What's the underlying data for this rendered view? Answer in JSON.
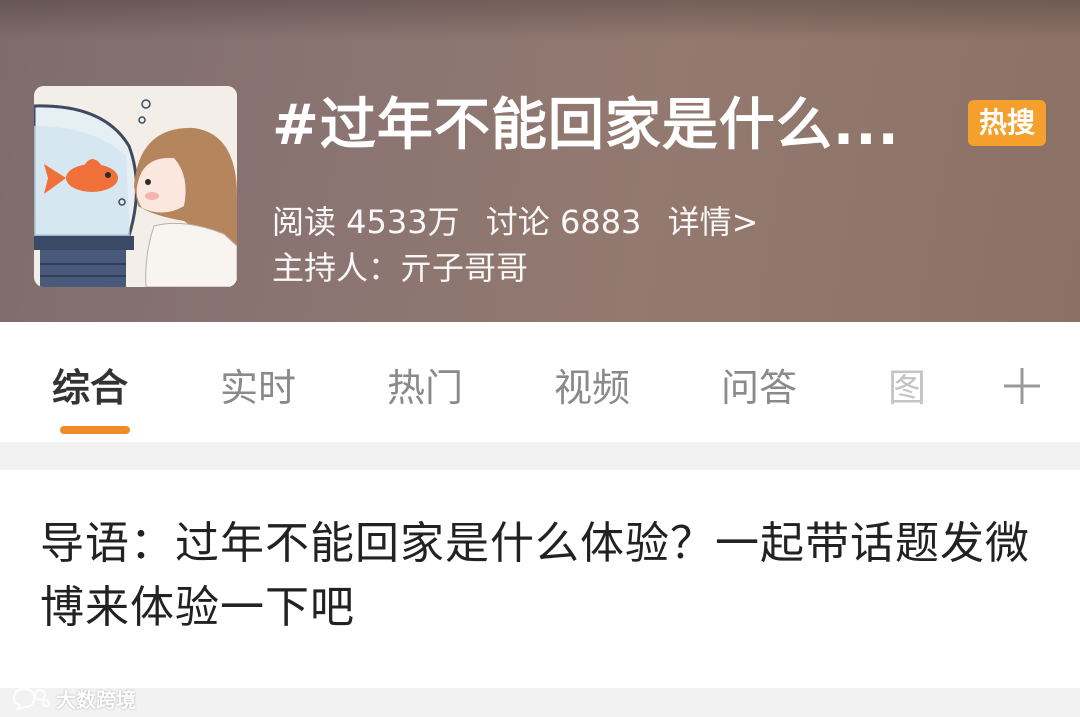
{
  "topic": {
    "title": "#过年不能回家是什么...",
    "badge": "热搜",
    "reads": "阅读 4533万",
    "discussions": "讨论 6883",
    "details_link": "详情>",
    "host": "主持人：亓子哥哥",
    "cover_icon": "girl-and-goldfish-illustration"
  },
  "tabs": [
    {
      "label": "综合",
      "active": true
    },
    {
      "label": "实时",
      "active": false
    },
    {
      "label": "热门",
      "active": false
    },
    {
      "label": "视频",
      "active": false
    },
    {
      "label": "问答",
      "active": false
    },
    {
      "label": "图",
      "active": false
    }
  ],
  "tab_add_icon": "plus-icon",
  "intro": {
    "text": "导语：过年不能回家是什么体验？一起带话题发微博来体验一下吧"
  },
  "watermark": {
    "text": "大数跨境",
    "icon": "bubble-logo-icon"
  },
  "colors": {
    "accent": "#f08a2c",
    "badge": "#f5a02c",
    "header_bg": "#8a7472"
  }
}
